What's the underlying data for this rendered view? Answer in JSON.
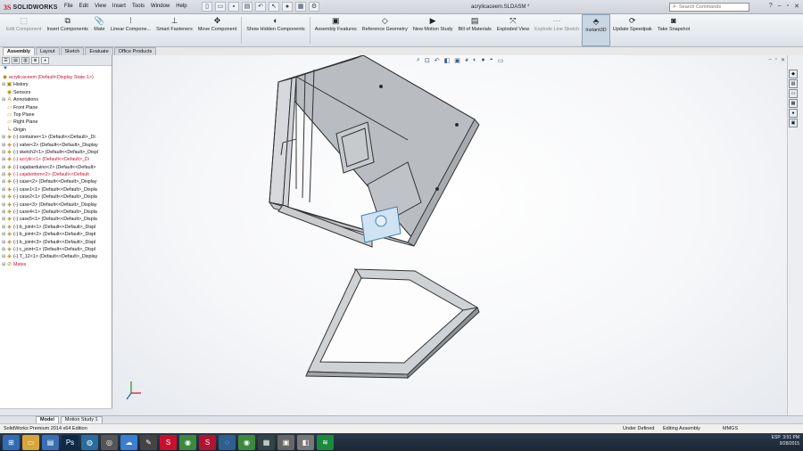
{
  "app": {
    "brand_ds": "3S",
    "brand_name": "SOLIDWORKS",
    "document_title": "acrylicaceem.SLDASM *"
  },
  "menus": [
    "File",
    "Edit",
    "View",
    "Insert",
    "Tools",
    "Window",
    "Help"
  ],
  "search": {
    "placeholder": "Search Commands"
  },
  "commands": [
    {
      "label": "Edit Component",
      "dim": true
    },
    {
      "label": "Insert Components"
    },
    {
      "label": "Mate"
    },
    {
      "label": "Linear Compone..."
    },
    {
      "label": "Smart Fasteners"
    },
    {
      "label": "Move Component"
    },
    {
      "label": "Show Hidden Components"
    },
    {
      "label": "Assembly Features"
    },
    {
      "label": "Reference Geometry"
    },
    {
      "label": "New Motion Study"
    },
    {
      "label": "Bill of Materials"
    },
    {
      "label": "Exploded View"
    },
    {
      "label": "Explode Line Sketch",
      "dim": true
    },
    {
      "label": "Instant3D",
      "active": true
    },
    {
      "label": "Update Speedpak"
    },
    {
      "label": "Take Snapshot"
    }
  ],
  "tabs": [
    "Assembly",
    "Layout",
    "Sketch",
    "Evaluate",
    "Office Products"
  ],
  "tree": [
    {
      "label": "acrylicaceem (Default<Display State-1>)",
      "type": "top"
    },
    {
      "label": "History"
    },
    {
      "label": "Sensors"
    },
    {
      "label": "Annotations"
    },
    {
      "label": "Front Plane"
    },
    {
      "label": "Top Plane"
    },
    {
      "label": "Right Plane"
    },
    {
      "label": "Origin"
    },
    {
      "label": "(-) container<1> (Default<<Default>_Di"
    },
    {
      "label": "(-) valve<2> (Default<<Default>_Display"
    },
    {
      "label": "(-) sketch2<1> (Default<<Default>_Displ"
    },
    {
      "label": "(-) acrylic<1> (Default<<Default>_Di",
      "type": "err"
    },
    {
      "label": "(-) cajabarduino<2> (Default<<Default>"
    },
    {
      "label": "(-) cajabottom<2> (Default<<Default",
      "type": "err"
    },
    {
      "label": "(-) case<2> (Default<<Default>_Display"
    },
    {
      "label": "(-) case1<1> (Default<<Default>_Displa"
    },
    {
      "label": "(-) case2<1> (Default<<Default>_Displa"
    },
    {
      "label": "(-) case<3> (Default<<Default>_Display"
    },
    {
      "label": "(-) case4<1> (Default<<Default>_Displa"
    },
    {
      "label": "(-) case5<1> (Default<<Default>_Displa"
    },
    {
      "label": "(-) b_joint<1> (Default<<Default>_Displ"
    },
    {
      "label": "(-) b_joint<2> (Default<<Default>_Displ"
    },
    {
      "label": "(-) b_joint<3> (Default<<Default>_Displ"
    },
    {
      "label": "(-) c_joint<1> (Default<<Default>_Displ"
    },
    {
      "label": "(-) T_12<1> (Default<<Default>_Display"
    },
    {
      "label": "Mates",
      "type": "err"
    }
  ],
  "model_tabs": [
    "Model",
    "Motion Study 1"
  ],
  "status": {
    "edition": "SolidWorks Premium 2014 x64 Edition",
    "defined": "Under Defined",
    "editing": "Editing Assembly",
    "units": "MMGS"
  },
  "clock": {
    "time": "3:51 PM",
    "date": "9/28/2015"
  },
  "lang": "ESP"
}
